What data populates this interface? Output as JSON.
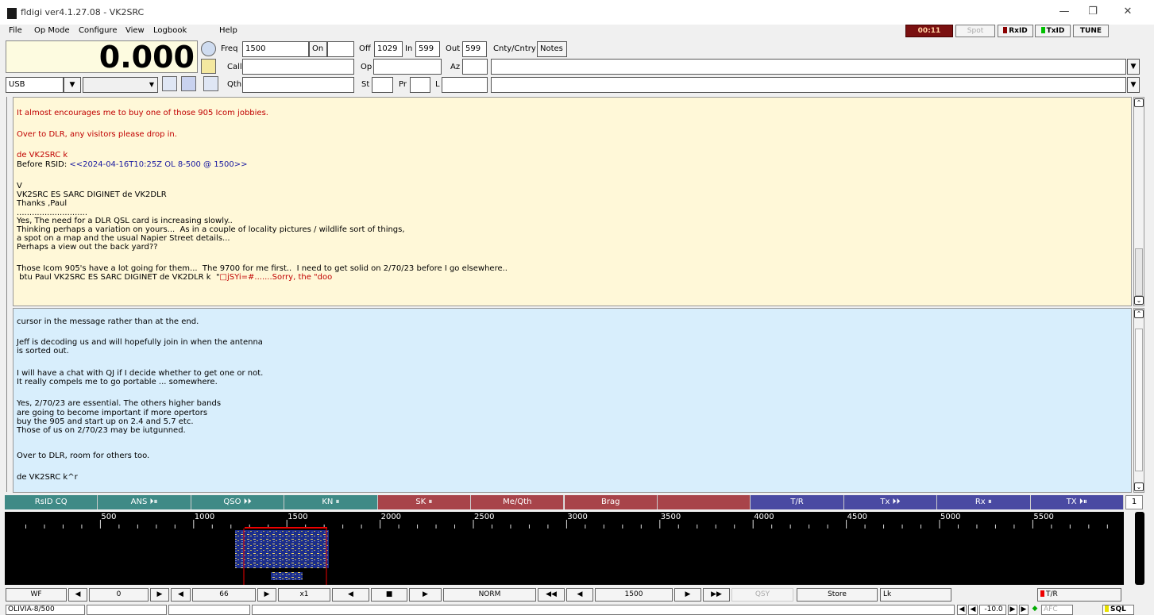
{
  "window": {
    "title": "fldigi ver4.1.27.08 - VK2SRC",
    "min_glyph": "—",
    "max_glyph": "❐",
    "close_glyph": "✕"
  },
  "menu": [
    "File",
    "Op Mode",
    "Configure",
    "View",
    "Logbook",
    "Help"
  ],
  "topright": {
    "timer": "00:11",
    "spot": "Spot",
    "rxid": "RxID",
    "txid": "TxID",
    "tune": "TUNE"
  },
  "freq_display": "0.000",
  "log": {
    "freq_label": "Freq",
    "freq_value": "1500",
    "on_label": "On",
    "off_label": "Off",
    "off_value": "1029",
    "in_label": "In",
    "in_value": "599",
    "out_label": "Out",
    "out_value": "599",
    "cnty": "Cnty/Cntry",
    "notes": "Notes",
    "call_label": "Call",
    "op_label": "Op",
    "az_label": "Az",
    "qth_label": "Qth",
    "st_label": "St",
    "pr_label": "Pr",
    "l_label": "L"
  },
  "mode_select": "USB",
  "rx_lines": [
    {
      "text": "It almost encourages me to buy one of those 905 Icom jobbies.",
      "cls": "red"
    },
    {
      "text": "Over to DLR, any visitors please drop in.",
      "cls": "red"
    },
    {
      "text": "de VK2SRC k",
      "cls": "red"
    },
    {
      "text": "Before RSID: ",
      "cls": ""
    },
    {
      "text": "V",
      "cls": ""
    },
    {
      "text": "VK2SRC ES SARC DIGINET de VK2DLR",
      "cls": ""
    },
    {
      "text": "Thanks ,Paul",
      "cls": ""
    },
    {
      "text": "............................",
      "cls": ""
    },
    {
      "text": "Yes, The need for a DLR QSL card is increasing slowly..",
      "cls": ""
    },
    {
      "text": "Thinking perhaps a variation on yours...  As in a couple of locality pictures / wildlife sort of things,",
      "cls": ""
    },
    {
      "text": "a spot on a map and the usual Napier Street details...",
      "cls": ""
    },
    {
      "text": "Perhaps a view out the back yard??",
      "cls": ""
    },
    {
      "text": "Those Icom 905's have a lot going for them...  The 9700 for me first..  I need to get solid on 2/70/23 before I go elsewhere..",
      "cls": ""
    },
    {
      "text": " btu Paul VK2SRC ES SARC DIGINET de VK2DLR k  \"",
      "cls": ""
    },
    {
      "text": "□jSYi=#.......Sorry, the \"doo",
      "cls": "red"
    }
  ],
  "rsid_tag": "<<2024-04-16T10:25Z OL 8-500 @ 1500>>",
  "tx_lines": [
    "cursor in the message rather than at the end.",
    "Jeff is decoding us and will hopefully join in when the antenna",
    "is sorted out.",
    "I will have a chat with QJ if I decide whether to get one or not.",
    "It really compels me to go portable ... somewhere.",
    "Yes, 2/70/23 are essential. The others higher bands",
    "are going to become important if more opertors",
    "buy the 905 and start up on 2.4 and 5.7 etc.",
    "Those of us on 2/70/23 may be iutgunned.",
    "Over to DLR, room for others too.",
    "de VK2SRC k^r"
  ],
  "macros": [
    {
      "label": "RsID CQ",
      "color": "#3f8a86"
    },
    {
      "label": "ANS ⏵⏸",
      "color": "#3f8a86"
    },
    {
      "label": "QSO ⏵⏵",
      "color": "#3f8a86"
    },
    {
      "label": "KN ⏸",
      "color": "#3f8a86"
    },
    {
      "label": "SK ⏸",
      "color": "#a8444a"
    },
    {
      "label": "Me/Qth",
      "color": "#a8444a"
    },
    {
      "label": "Brag",
      "color": "#a8444a"
    },
    {
      "label": "",
      "color": "#a8444a"
    },
    {
      "label": "T/R",
      "color": "#4a4aa2"
    },
    {
      "label": "Tx ⏵⏵",
      "color": "#4a4aa2"
    },
    {
      "label": "Rx ⏸",
      "color": "#4a4aa2"
    },
    {
      "label": "TX ⏵⏸",
      "color": "#4a4aa2"
    }
  ],
  "macro_bank": "1",
  "scale_ticks": [
    "500",
    "1000",
    "1500",
    "2000",
    "2500",
    "3000",
    "3500",
    "4000",
    "4500",
    "5000",
    "5500"
  ],
  "bottom": {
    "wf": "WF",
    "val0": "0",
    "val66": "66",
    "x1": "x1",
    "norm": "NORM",
    "freq": "1500",
    "qsy": "QSY",
    "store": "Store",
    "lk": "Lk",
    "tr": "T/R"
  },
  "status": {
    "mode": "OLIVIA-8/500",
    "s2": "",
    "s3": "",
    "s4": "",
    "db": "-10.0",
    "afc": "AFC",
    "sql": "SQL"
  }
}
